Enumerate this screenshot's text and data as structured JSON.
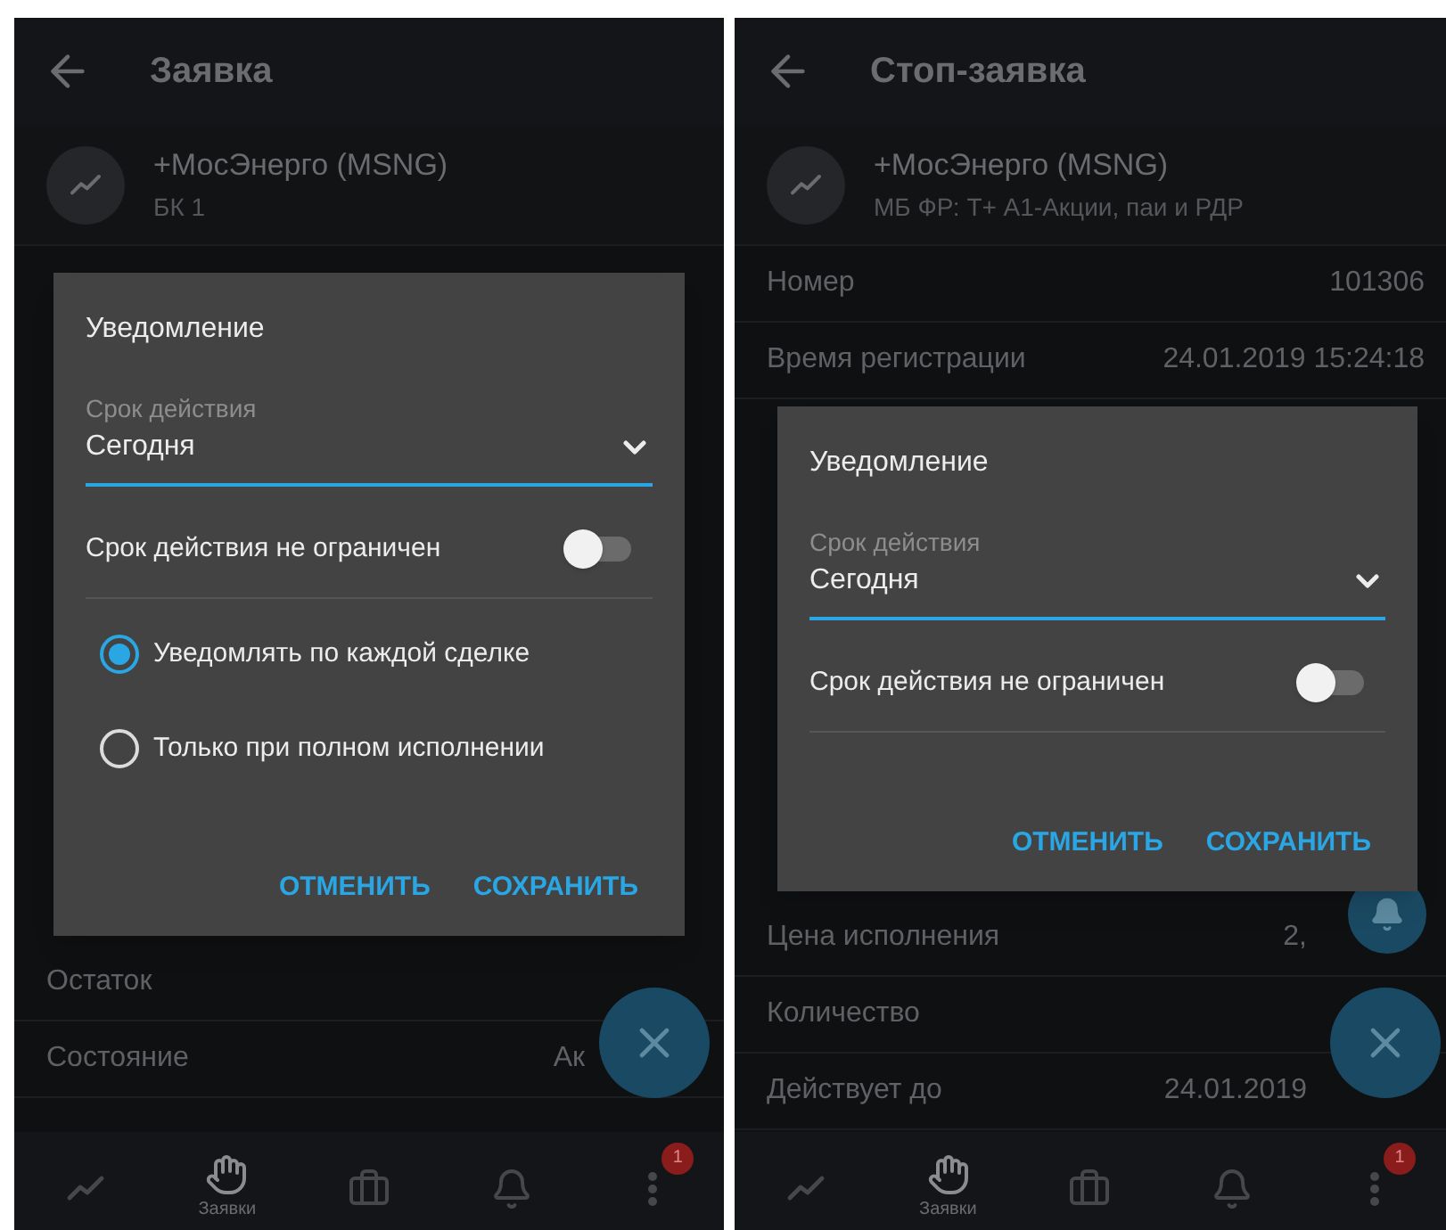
{
  "screens": [
    {
      "header": {
        "title": "Заявка"
      },
      "instrument": {
        "name": "+МосЭнерго (MSNG)",
        "subtitle": "БК 1"
      },
      "rows_bottom": [
        {
          "label": "Остаток"
        },
        {
          "label": "Состояние",
          "value": "Ак"
        }
      ],
      "fabs": [
        {
          "kind": "close"
        }
      ],
      "dialog": {
        "title": "Уведомление",
        "field": {
          "label": "Срок действия",
          "value": "Сегодня"
        },
        "toggle": {
          "label": "Срок действия не ограничен",
          "on": false
        },
        "radios": [
          {
            "label": "Уведомлять по каждой сделке",
            "selected": true
          },
          {
            "label": "Только при полном исполнении",
            "selected": false
          }
        ],
        "buttons": [
          "ОТМЕНИТЬ",
          "СОХРАНИТЬ"
        ]
      },
      "nav": [
        {
          "kind": "chart",
          "selected": false
        },
        {
          "kind": "hand",
          "label": "Заявки",
          "selected": true
        },
        {
          "kind": "briefcase",
          "selected": false
        },
        {
          "kind": "bell",
          "selected": false
        },
        {
          "kind": "more",
          "badge": "1",
          "selected": false
        }
      ]
    },
    {
      "header": {
        "title": "Стоп-заявка"
      },
      "instrument": {
        "name": "+МосЭнерго (MSNG)",
        "subtitle": "МБ ФР: Т+ А1-Акции, паи и РДР"
      },
      "rows_top": [
        {
          "label": "Номер",
          "value": "101306"
        },
        {
          "label": "Время регистрации",
          "value": "24.01.2019 15:24:18"
        }
      ],
      "rows_bottom": [
        {
          "label": "Цена исполнения",
          "value": "2,"
        },
        {
          "label": "Количество"
        },
        {
          "label": "Действует до",
          "value": "24.01.2019"
        }
      ],
      "fabs": [
        {
          "kind": "bell"
        },
        {
          "kind": "close"
        }
      ],
      "dialog": {
        "title": "Уведомление",
        "field": {
          "label": "Срок действия",
          "value": "Сегодня"
        },
        "toggle": {
          "label": "Срок действия не ограничен",
          "on": false
        },
        "buttons": [
          "ОТМЕНИТЬ",
          "СОХРАНИТЬ"
        ]
      },
      "nav": [
        {
          "kind": "chart",
          "selected": false
        },
        {
          "kind": "hand",
          "label": "Заявки",
          "selected": true
        },
        {
          "kind": "briefcase",
          "selected": false
        },
        {
          "kind": "bell",
          "selected": false
        },
        {
          "kind": "more",
          "badge": "1",
          "selected": false
        }
      ]
    }
  ]
}
